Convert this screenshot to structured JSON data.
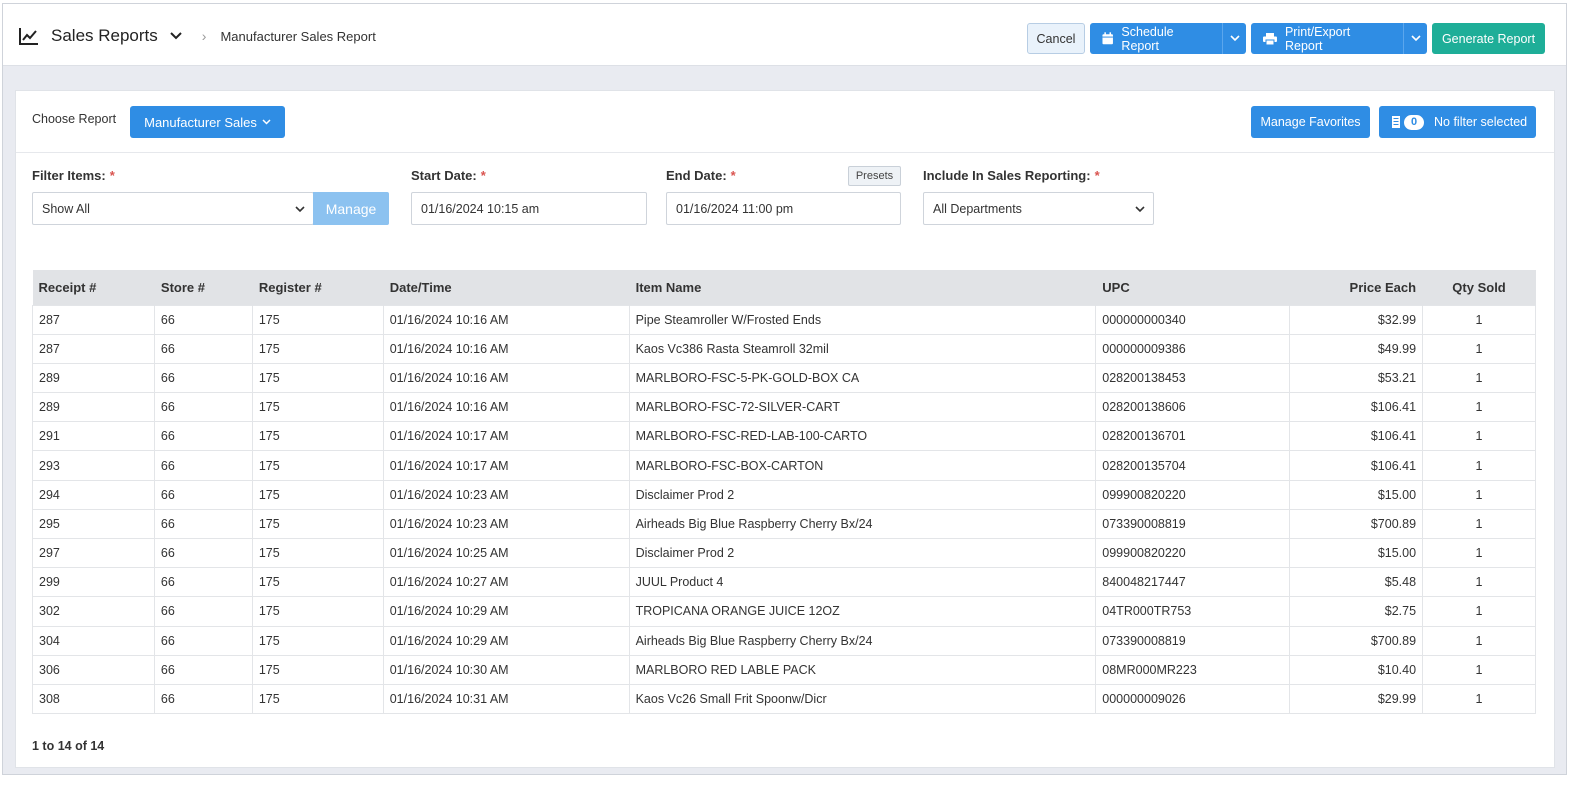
{
  "header": {
    "title": "Sales Reports",
    "breadcrumb": "Manufacturer Sales Report",
    "cancel_label": "Cancel",
    "schedule_label": "Schedule Report",
    "print_label": "Print/Export Report",
    "generate_label": "Generate Report"
  },
  "toolbar": {
    "choose_label": "Choose Report",
    "report_selected": "Manufacturer Sales",
    "favorites_label": "Manage Favorites",
    "filter_count": "0",
    "filter_label": "No filter selected"
  },
  "filters": {
    "filter_items_label": "Filter Items:",
    "filter_items_value": "Show All",
    "manage_label": "Manage",
    "start_label": "Start Date:",
    "start_value": "01/16/2024 10:15 am",
    "end_label": "End Date:",
    "end_value": "01/16/2024 11:00 pm",
    "presets_label": "Presets",
    "include_label": "Include In Sales Reporting:",
    "include_value": "All Departments",
    "required_mark": "*"
  },
  "table": {
    "columns": [
      "Receipt #",
      "Store #",
      "Register #",
      "Date/Time",
      "Item Name",
      "UPC",
      "Price Each",
      "Qty Sold"
    ],
    "rows": [
      [
        "287",
        "66",
        "175",
        "01/16/2024 10:16 AM",
        "Pipe Steamroller W/Frosted Ends",
        "000000000340",
        "$32.99",
        "1"
      ],
      [
        "287",
        "66",
        "175",
        "01/16/2024 10:16 AM",
        "Kaos Vc386 Rasta Steamroll 32mil",
        "000000009386",
        "$49.99",
        "1"
      ],
      [
        "289",
        "66",
        "175",
        "01/16/2024 10:16 AM",
        "MARLBORO-FSC-5-PK-GOLD-BOX CA",
        "028200138453",
        "$53.21",
        "1"
      ],
      [
        "289",
        "66",
        "175",
        "01/16/2024 10:16 AM",
        "MARLBORO-FSC-72-SILVER-CART",
        "028200138606",
        "$106.41",
        "1"
      ],
      [
        "291",
        "66",
        "175",
        "01/16/2024 10:17 AM",
        "MARLBORO-FSC-RED-LAB-100-CARTO",
        "028200136701",
        "$106.41",
        "1"
      ],
      [
        "293",
        "66",
        "175",
        "01/16/2024 10:17 AM",
        "MARLBORO-FSC-BOX-CARTON",
        "028200135704",
        "$106.41",
        "1"
      ],
      [
        "294",
        "66",
        "175",
        "01/16/2024 10:23 AM",
        "Disclaimer Prod 2",
        "099900820220",
        "$15.00",
        "1"
      ],
      [
        "295",
        "66",
        "175",
        "01/16/2024 10:23 AM",
        "Airheads Big Blue Raspberry Cherry Bx/24",
        "073390008819",
        "$700.89",
        "1"
      ],
      [
        "297",
        "66",
        "175",
        "01/16/2024 10:25 AM",
        "Disclaimer Prod 2",
        "099900820220",
        "$15.00",
        "1"
      ],
      [
        "299",
        "66",
        "175",
        "01/16/2024 10:27 AM",
        "JUUL Product 4",
        "840048217447",
        "$5.48",
        "1"
      ],
      [
        "302",
        "66",
        "175",
        "01/16/2024 10:29 AM",
        "TROPICANA ORANGE JUICE 12OZ",
        "04TR000TR753",
        "$2.75",
        "1"
      ],
      [
        "304",
        "66",
        "175",
        "01/16/2024 10:29 AM",
        "Airheads Big Blue Raspberry Cherry Bx/24",
        "073390008819",
        "$700.89",
        "1"
      ],
      [
        "306",
        "66",
        "175",
        "01/16/2024 10:30 AM",
        "MARLBORO RED LABLE PACK",
        "08MR000MR223",
        "$10.40",
        "1"
      ],
      [
        "308",
        "66",
        "175",
        "01/16/2024 10:31 AM",
        "Kaos Vc26 Small Frit Spoonw/Dicr",
        "000000009026",
        "$29.99",
        "1"
      ]
    ],
    "pager": "1 to 14 of 14"
  }
}
